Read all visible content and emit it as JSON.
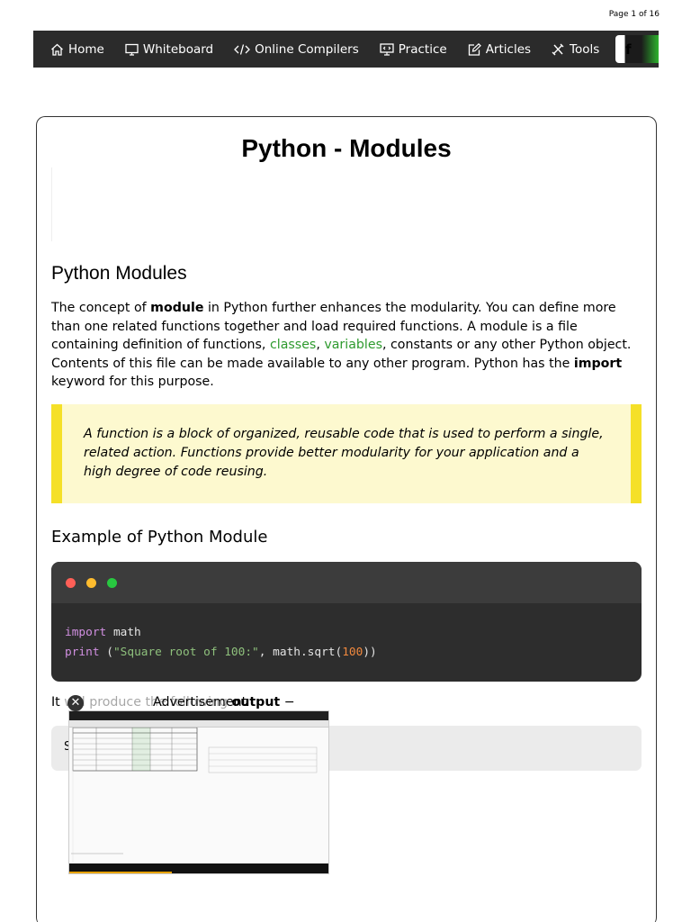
{
  "page_number": "Page 1 of 16",
  "nav": {
    "home": "Home",
    "whiteboard": "Whiteboard",
    "compilers": "Online Compilers",
    "practice": "Practice",
    "articles": "Articles",
    "tools": "Tools",
    "facebook": "f"
  },
  "title": "Python - Modules",
  "section1": {
    "heading": "Python Modules",
    "p_before_module": "The concept of ",
    "module_bold": "module",
    "p_after_module": " in Python further enhances the modularity. You can define more than one related functions together and load required functions. A module is a file containing definition of functions, ",
    "link_classes": "classes",
    "comma": ", ",
    "link_variables": "variables",
    "p_after_variables": ", constants or any other Python object. Contents of this file can be made available to any other program. Python has the ",
    "import_bold": "import",
    "p_end": " keyword for this purpose."
  },
  "note": "A function is a block of organized, reusable code that is used to perform a single, related action. Functions provide better modularity for your application and a high degree of code reusing.",
  "section2": {
    "heading": "Example of Python Module"
  },
  "code": {
    "line1_kw": "import",
    "line1_rest": " math",
    "line2_kw": "print",
    "line2_open": " (",
    "line2_str": "\"Square root of 100:\"",
    "line2_mid": ", math.sqrt(",
    "line2_num": "100",
    "line2_close": "))"
  },
  "output_intro_start": "It ",
  "output_intro_hidden": "will produce the following ",
  "output_intro_bold": "output",
  "output_intro_end": " −",
  "output_overlap_text": "Advertisement",
  "output_value": "S",
  "colors": {
    "nav_bg": "#2b2b2b",
    "link_green": "#2e9a2e",
    "note_bg": "#fdf9cf",
    "note_border": "#f5e028",
    "code_bg": "#2d2d2d",
    "dot_red": "#ff5f57",
    "dot_yellow": "#febc2e",
    "dot_green": "#28c840"
  },
  "ad_close_icon": "close-icon"
}
